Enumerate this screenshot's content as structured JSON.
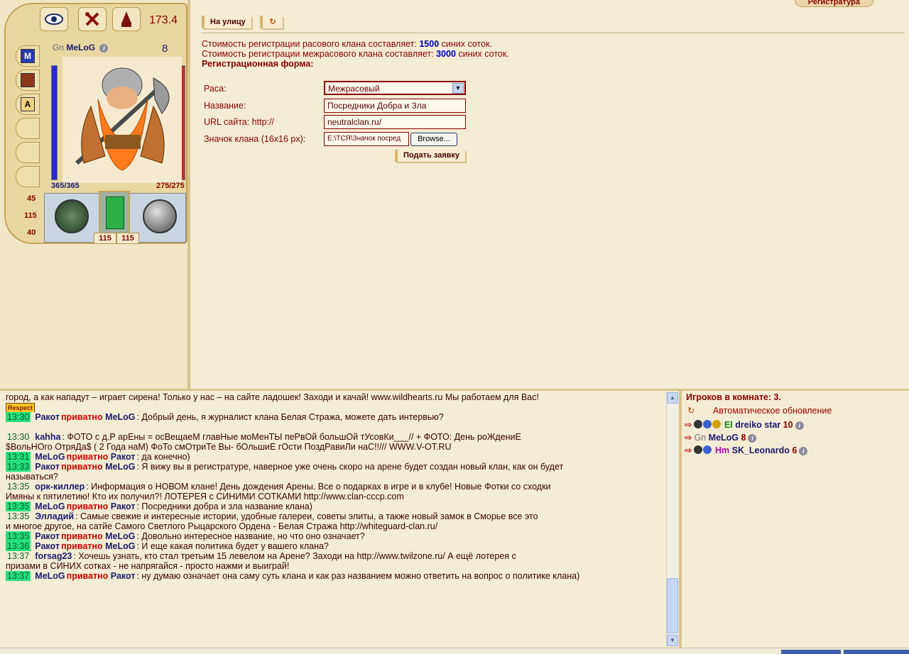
{
  "character": {
    "weight": "173.4",
    "race": "Gn",
    "name": "MeLoG",
    "level": "8",
    "hp": "365/365",
    "mana": "275/275",
    "stats": [
      "45",
      "115",
      "40"
    ],
    "armor": [
      "115",
      "115"
    ],
    "top_buttons": [
      "eye-icon",
      "tools-icon",
      "wizard-icon"
    ],
    "side_buttons": [
      "spellbook-icon",
      "book-icon",
      "letter-a-icon"
    ]
  },
  "main": {
    "tab_label": "Регистратура",
    "nav": {
      "street_label": "На улицу",
      "refresh_icon": "refresh-icon"
    },
    "cost_line1": {
      "prefix": "Стоимость регистрации расового клана составляет:",
      "amount": "1500",
      "suffix": "синих соток."
    },
    "cost_line2": {
      "prefix": "Стоимость регистрации межрасового клана составляет:",
      "amount": "3000",
      "suffix": "синих соток."
    },
    "form_title": "Регистрационная форма:",
    "form": {
      "race_label": "Раса:",
      "race_value": "Межрасовый",
      "name_label": "Название:",
      "name_value": "Посредники Добра и Зла",
      "url_label": "URL сайта: http://",
      "url_value": "neutralclan.ru/",
      "icon_label": "Значок клана (16x16 px):",
      "icon_value": "E:\\ТСЯ\\Значок посред",
      "browse_label": "Browse...",
      "submit_label": "Подать заявку"
    }
  },
  "chat": {
    "messages": [
      {
        "time": "",
        "highlight": false,
        "author": "",
        "private_to": "",
        "text": "город, а как нападут – играет сирена! Только у нас – на сайте ладошек! Заходи и качай! www.wildhearts.ru Мы работаем для Вас!"
      },
      {
        "time": "",
        "highlight": false,
        "author": "",
        "private_to": "",
        "text": ""
      },
      {
        "time": "13:30",
        "highlight": true,
        "author": "Ракот",
        "private_to": "MeLoG",
        "text": ": Добрый день, я журналист клана Белая Стража, можете дать интервью?"
      },
      {
        "time": "",
        "highlight": false,
        "author": "",
        "private_to": "",
        "text": ""
      },
      {
        "time": "13:30",
        "highlight": false,
        "author": "kahha",
        "private_to": "",
        "text": ": ФОТО с д.Р арЕны = осВещаеМ главНые моМенТЫ пеРвОй большОй тУсовКи___// + ФОТО: День роЖдениЕ"
      },
      {
        "time": "",
        "highlight": false,
        "author": "",
        "private_to": "",
        "text": "$ВольНОго ОтряДа$ ( 2 Года наМ) ФоТо смОтриТе Вы- бОльшиЕ гОсти ПоздРавиЛи наС!!/// WWW.V-OT.RU"
      },
      {
        "time": "13:31",
        "highlight": true,
        "author": "MeLoG",
        "private_to": "Ракот",
        "text": ": да конечно)"
      },
      {
        "time": "13:33",
        "highlight": true,
        "author": "Ракот",
        "private_to": "MeLoG",
        "text": ": Я вижу вы в регистратуре, наверное уже очень скоро на арене будет создан новый клан, как он будет"
      },
      {
        "time": "",
        "highlight": false,
        "author": "",
        "private_to": "",
        "text": "называться?"
      },
      {
        "time": "13:35",
        "highlight": false,
        "author": "орк-киллер",
        "private_to": "",
        "text": ": Информация о НОВОМ клане! День дождения Арены. Все о подарках в игре и в клубе! Новые Фотки со сходки"
      },
      {
        "time": "",
        "highlight": false,
        "author": "",
        "private_to": "",
        "text": "Имяны к пятилетию! Кто их получил?! ЛОТЕРЕЯ с СИНИМИ СОТКАМИ http://www.clan-cccp.com"
      },
      {
        "time": "13:35",
        "highlight": true,
        "author": "MeLoG",
        "private_to": "Ракот",
        "text": ": Посредники добра и зла название клана)"
      },
      {
        "time": "13:35",
        "highlight": false,
        "author": "Элладий",
        "private_to": "",
        "text": ": Самые свежие и интересные истории, удобные галереи, советы элиты, а также новый замок в Сморье все это"
      },
      {
        "time": "",
        "highlight": false,
        "author": "",
        "private_to": "",
        "text": "и многое другое, на сатйе Самого Светлого Рыцарского Ордена - Белая Стража http://whiteguard-clan.ru/"
      },
      {
        "time": "13:35",
        "highlight": true,
        "author": "Ракот",
        "private_to": "MeLoG",
        "text": ": Довольно интересное название, но что оно означает?"
      },
      {
        "time": "13:36",
        "highlight": true,
        "author": "Ракот",
        "private_to": "MeLoG",
        "text": ": И еще какая политика будет у вашего клана?"
      },
      {
        "time": "13:37",
        "highlight": false,
        "author": "forsag23",
        "private_to": "",
        "text": ": Хочешь узнать, кто стал третьим 15 левелом на Арене? Заходи на http://www.twilzone.ru/ А ещё лотерея с"
      },
      {
        "time": "",
        "highlight": false,
        "author": "",
        "private_to": "",
        "text": "призами в СИНИХ сотках - не напрягайся - просто нажми и выиграй!"
      },
      {
        "time": "13:37",
        "highlight": true,
        "author": "MeLoG",
        "private_to": "Ракот",
        "text": ": ну думаю означает она саму суть клана и как раз названием можно ответить на вопрос о политике клана)"
      }
    ],
    "private_word": "приватно",
    "respect_badge": "Respect"
  },
  "players": {
    "header": "Игроков в комнате: 3.",
    "auto_update_label": "Автоматическое обновление",
    "list": [
      {
        "race": "El",
        "name": "dreiko star",
        "level": "10",
        "race_color": "#0a8a0a"
      },
      {
        "race": "Gn",
        "name": "MeLoG",
        "level": "8",
        "race_color": "#777777"
      },
      {
        "race": "Hm",
        "name": "SK_Leonardo",
        "level": "6",
        "race_color": "#b000b0"
      }
    ]
  }
}
